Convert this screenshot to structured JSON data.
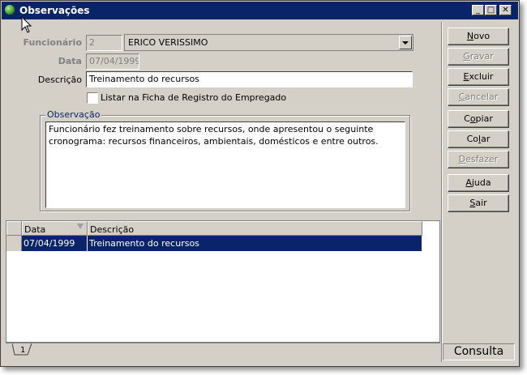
{
  "window": {
    "title": "Observações",
    "minimize": "_",
    "maximize": "□",
    "close": "✕"
  },
  "form": {
    "funcionario_label": "Funcionário",
    "funcionario_code": "2",
    "funcionario_name": "ERICO VERISSIMO",
    "data_label": "Data",
    "data_value": "07/04/1999",
    "descricao_label": "Descrição",
    "descricao_value": "Treinamento do recursos",
    "listar_label": "Listar na Ficha de Registro do Empregado",
    "listar_checked": false,
    "observacao_label": "Observação",
    "observacao_text": "Funcionário fez treinamento sobre recursos, onde apresentou o seguinte cronograma: recursos financeiros, ambientais, domésticos e entre outros."
  },
  "grid": {
    "columns": [
      "Data",
      "Descrição"
    ],
    "rows": [
      {
        "data": "07/04/1999",
        "descricao": "Treinamento do recursos",
        "selected": true
      }
    ]
  },
  "tab": {
    "label": "1"
  },
  "buttons": [
    {
      "pre": "",
      "key": "N",
      "post": "ovo",
      "enabled": true
    },
    {
      "pre": "",
      "key": "G",
      "post": "ravar",
      "enabled": false
    },
    {
      "pre": "",
      "key": "E",
      "post": "xcluir",
      "enabled": true
    },
    {
      "pre": "",
      "key": "C",
      "post": "ancelar",
      "enabled": false
    },
    {
      "pre": "C",
      "key": "o",
      "post": "piar",
      "enabled": true
    },
    {
      "pre": "Co",
      "key": "l",
      "post": "ar",
      "enabled": true
    },
    {
      "pre": "",
      "key": "D",
      "post": "esfazer",
      "enabled": false
    },
    {
      "pre": "",
      "key": "A",
      "post": "juda",
      "enabled": true
    },
    {
      "pre": "",
      "key": "S",
      "post": "air",
      "enabled": true
    }
  ],
  "status": {
    "mode": "Consulta"
  },
  "colors": {
    "titlebar": "#0a246a",
    "face": "#d4d0c8",
    "selection": "#0a246a"
  }
}
